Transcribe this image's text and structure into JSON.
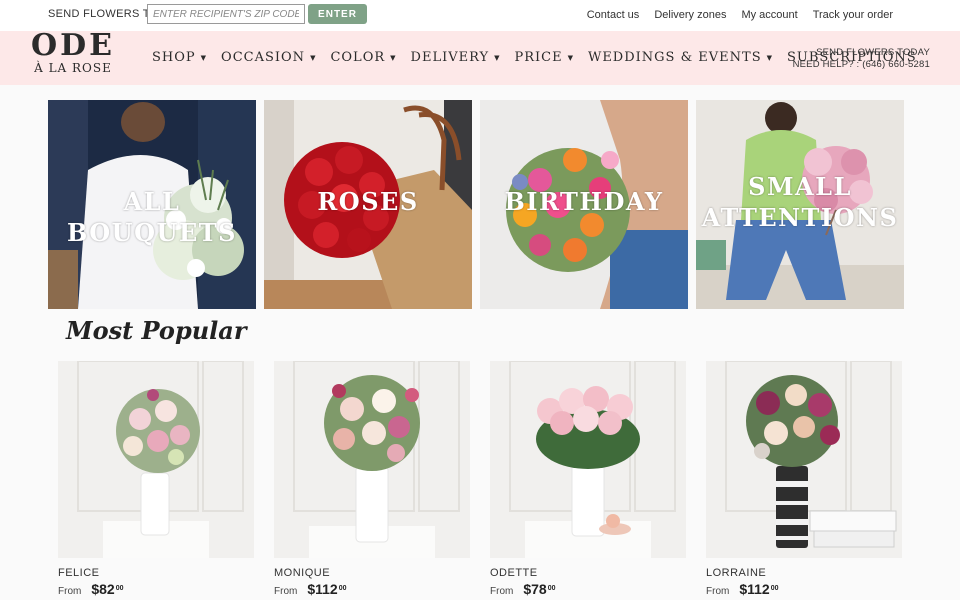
{
  "topbar": {
    "send_label": "SEND FLOWERS TO",
    "zip_placeholder": "ENTER RECIPIENT'S ZIP CODE",
    "enter_label": "ENTER",
    "links": [
      "Contact us",
      "Delivery zones",
      "My account",
      "Track your order"
    ]
  },
  "header": {
    "logo_main": "ODE",
    "logo_sub": "À LA ROSE",
    "nav": [
      "SHOP",
      "OCCASION",
      "COLOR",
      "DELIVERY",
      "PRICE",
      "WEDDINGS & EVENTS",
      "SUBSCRIPTIONS"
    ],
    "right_line1": "SEND FLOWERS TODAY",
    "right_line2": "NEED HELP? : (646) 660-5281"
  },
  "tiles": [
    {
      "label_lines": [
        "ALL BOUQUETS"
      ],
      "theme": "white-bouquet"
    },
    {
      "label_lines": [
        "ROSES"
      ],
      "theme": "red-roses"
    },
    {
      "label_lines": [
        "BIRTHDAY"
      ],
      "theme": "colorful"
    },
    {
      "label_lines": [
        "SMALL",
        "ATTENTIONS"
      ],
      "theme": "pink-blossom"
    }
  ],
  "section_title": "Most Popular",
  "products": [
    {
      "name": "FELICE",
      "from": "From",
      "dollars": "$82",
      "cents": "00"
    },
    {
      "name": "MONIQUE",
      "from": "From",
      "dollars": "$112",
      "cents": "00"
    },
    {
      "name": "ODETTE",
      "from": "From",
      "dollars": "$78",
      "cents": "00"
    },
    {
      "name": "LORRAINE",
      "from": "From",
      "dollars": "$112",
      "cents": "00"
    }
  ],
  "colors": {
    "header_bg": "#fde8e8",
    "enter_btn": "#7fa287"
  }
}
